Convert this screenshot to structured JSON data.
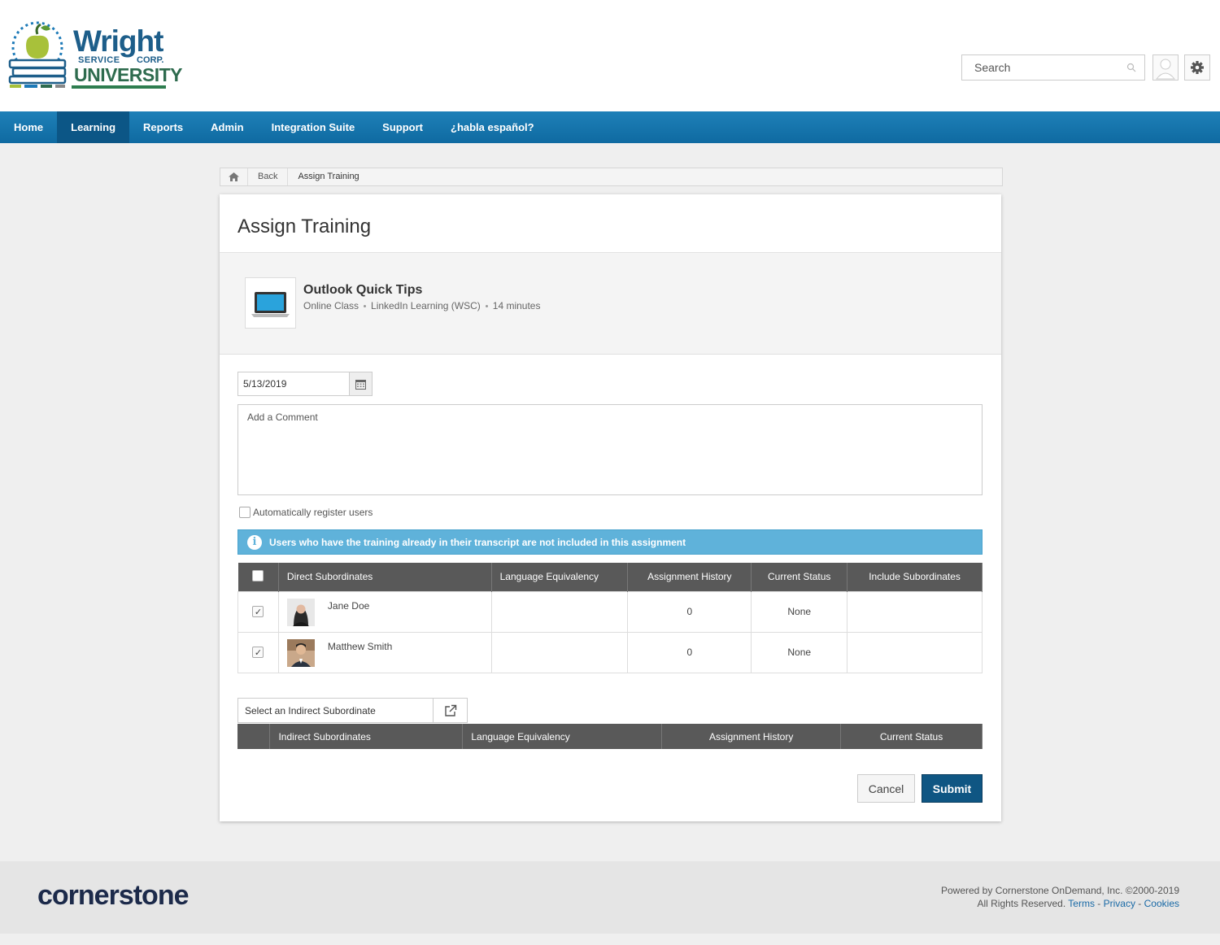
{
  "brand": {
    "wright": "Wright",
    "service": "SERVICE",
    "corp": "CORP.",
    "university": "UNIVERSITY",
    "apple_color": "#a8c13a",
    "primary": "#1d5e8a"
  },
  "header": {
    "search_placeholder": "Search"
  },
  "nav": {
    "items": [
      {
        "label": "Home"
      },
      {
        "label": "Learning"
      },
      {
        "label": "Reports"
      },
      {
        "label": "Admin"
      },
      {
        "label": "Integration Suite"
      },
      {
        "label": "Support"
      },
      {
        "label": "¿habla español?"
      }
    ],
    "active": "Learning",
    "color": "#1e80b8"
  },
  "breadcrumb": {
    "back": "Back",
    "current": "Assign Training"
  },
  "page": {
    "title": "Assign Training"
  },
  "training": {
    "name": "Outlook Quick Tips",
    "type": "Online Class",
    "provider": "LinkedIn Learning (WSC)",
    "duration": "14 minutes"
  },
  "form": {
    "due_date": "5/13/2019",
    "comment_placeholder": "Add a Comment",
    "auto_register_label": "Automatically register users",
    "info_message": "Users who have the training already in their transcript are not included in this assignment"
  },
  "direct_table": {
    "columns": [
      "Direct Subordinates",
      "Language Equivalency",
      "Assignment History",
      "Current Status",
      "Include Subordinates"
    ],
    "rows": [
      {
        "name": "Jane Doe",
        "language": "",
        "history": "0",
        "status": "None",
        "include": "",
        "checked": true
      },
      {
        "name": "Matthew Smith",
        "language": "",
        "history": "0",
        "status": "None",
        "include": "",
        "checked": true
      }
    ]
  },
  "indirect": {
    "select_placeholder": "Select an Indirect Subordinate",
    "columns": [
      "Indirect Subordinates",
      "Language Equivalency",
      "Assignment History",
      "Current Status"
    ]
  },
  "actions": {
    "cancel": "Cancel",
    "submit": "Submit",
    "submit_color": "#0f5683"
  },
  "footer": {
    "logo": "cornerstone",
    "powered": "Powered by Cornerstone OnDemand, Inc. ©2000-2019",
    "rights": "All Rights Reserved.",
    "terms": "Terms",
    "privacy": "Privacy",
    "cookies": "Cookies"
  }
}
